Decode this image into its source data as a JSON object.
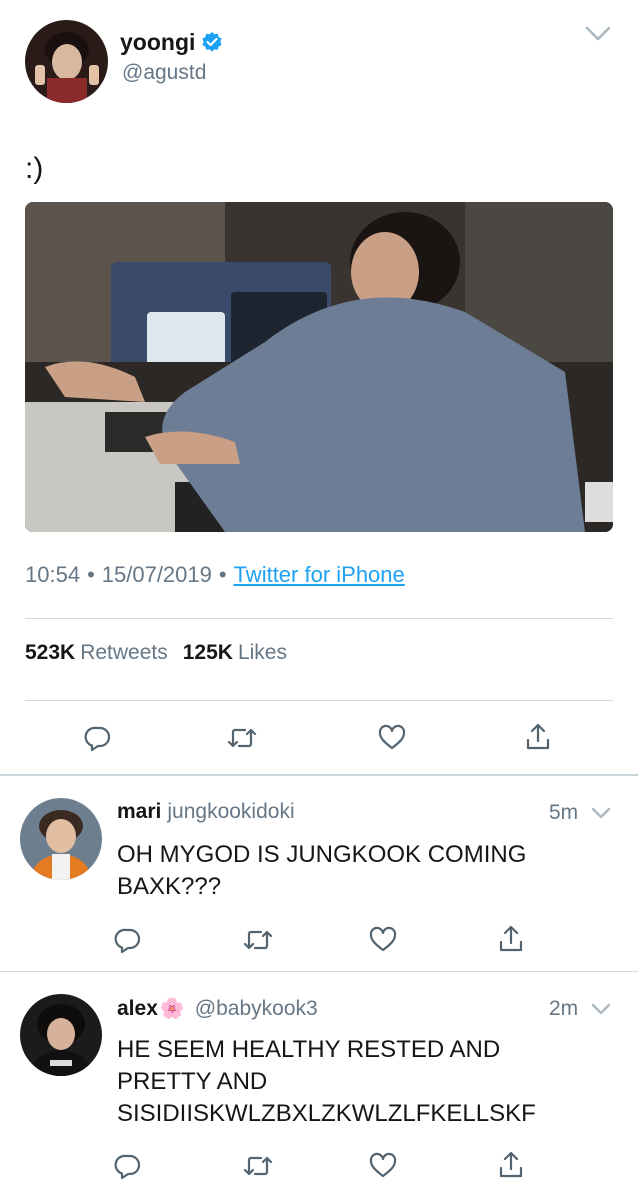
{
  "main_tweet": {
    "display_name": "yoongi",
    "handle": "@agustd",
    "text": ":)",
    "time": "10:54",
    "date": "15/07/2019",
    "separator": "•",
    "source": "Twitter for iPhone",
    "retweets_count": "523K",
    "retweets_label": "Retweets",
    "likes_count": "125K",
    "likes_label": "Likes"
  },
  "replies": [
    {
      "display_name": "mari",
      "handle": "jungkookidoki",
      "time": "5m",
      "text_line1": "OH MYGOD IS JUNGKOOK COMING",
      "text_line2": "BAXK???"
    },
    {
      "display_name": "alex",
      "emoji": "🌸",
      "handle": "@babykook3",
      "time": "2m",
      "text_line1": "HE SEEM HEALTHY RESTED AND",
      "text_line2": "PRETTY AND",
      "text_line3": "SISIDIISKWLZBXLZKWLZLFKELLSKF"
    }
  ],
  "colors": {
    "verified": "#1da1f2",
    "link": "#1da1f2",
    "muted": "#657786",
    "icon": "#536471"
  },
  "icons": [
    "verified-badge-icon",
    "chevron-down-icon",
    "reply-icon",
    "retweet-icon",
    "like-icon",
    "share-icon"
  ]
}
